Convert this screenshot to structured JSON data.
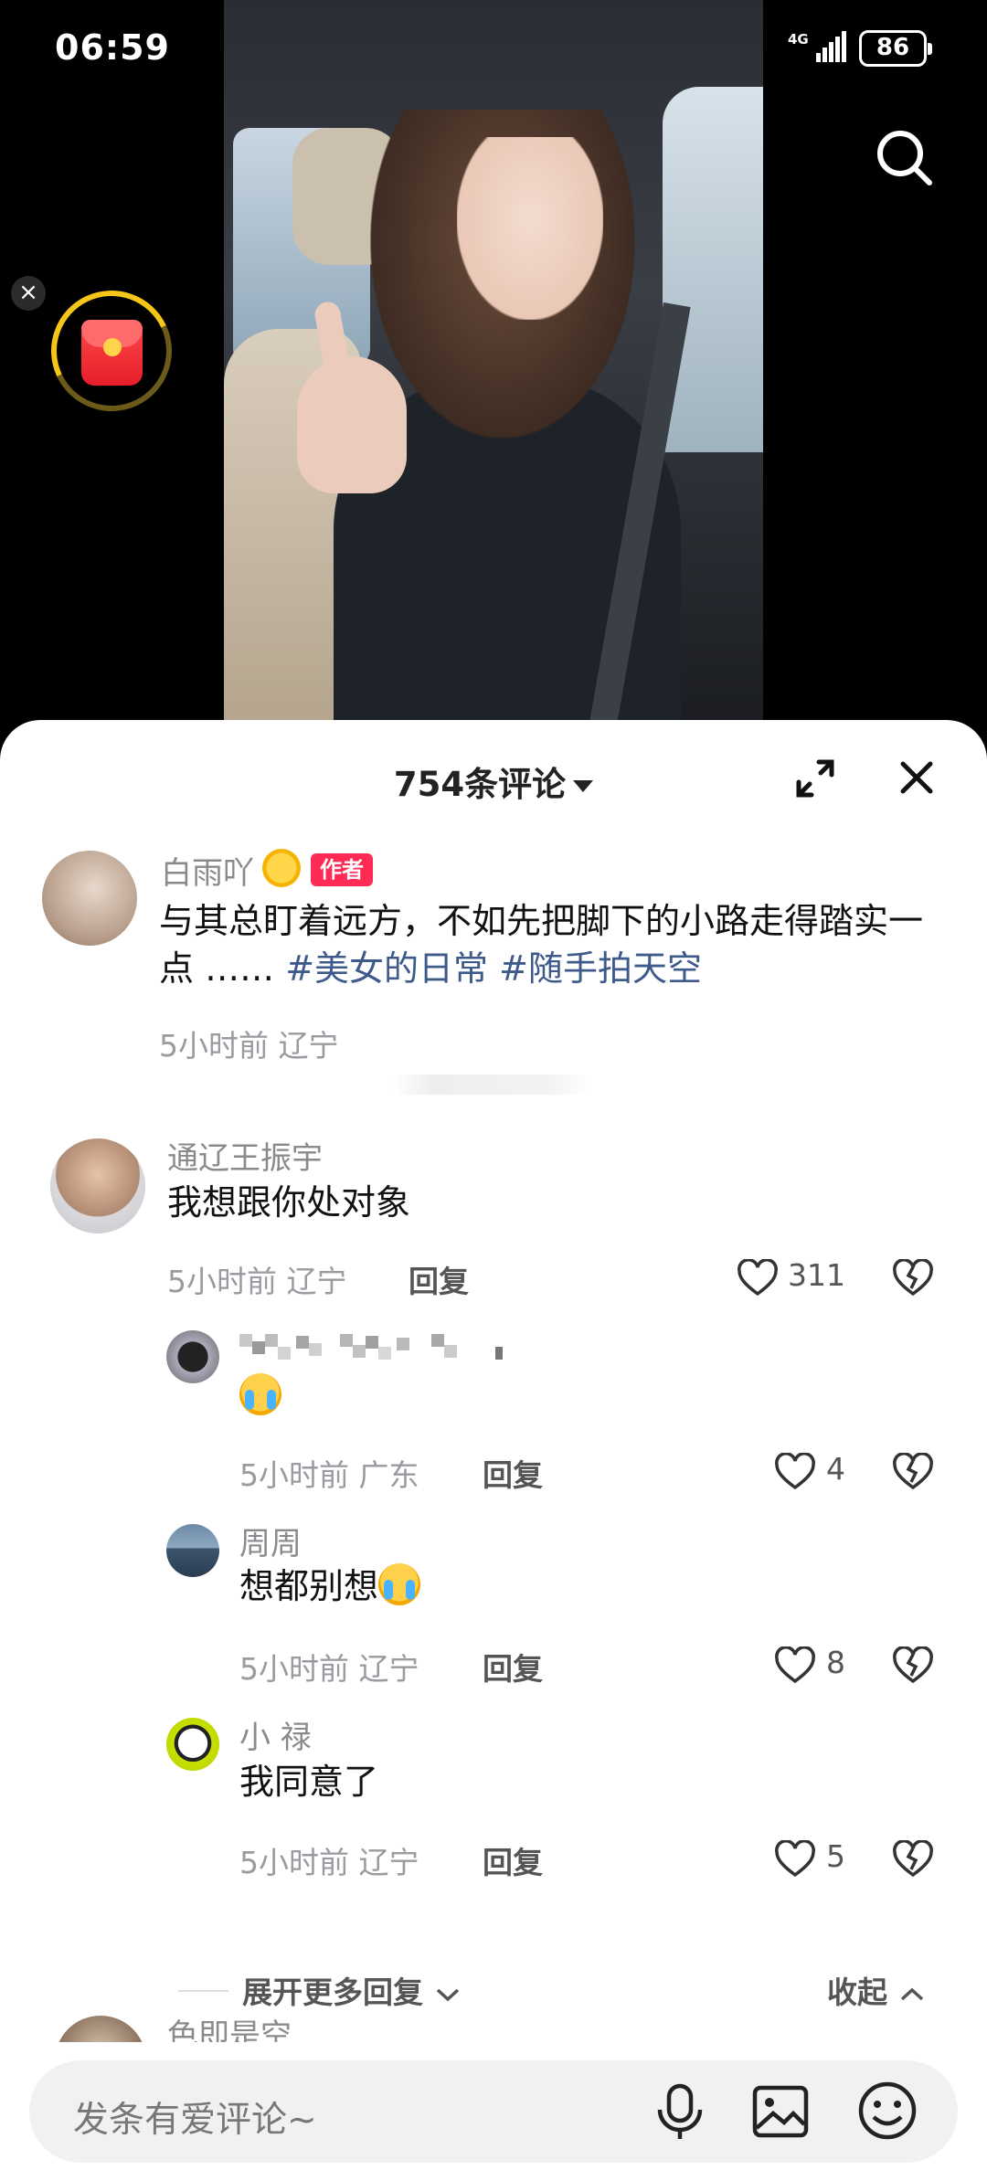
{
  "status_bar": {
    "time": "06:59",
    "network": "4G",
    "battery": "86"
  },
  "sheet": {
    "title": "754条评论"
  },
  "post": {
    "author_name": "白雨吖",
    "author_badge": "作者",
    "text_main": "与其总盯着远方，不如先把脚下的小路走得踏实一点 ……",
    "hashtags": [
      "#美女的日常",
      "#随手拍天空"
    ],
    "meta": "5小时前 辽宁"
  },
  "comments": [
    {
      "name": "通辽王振宇",
      "text": "我想跟你处对象",
      "meta": "5小时前 辽宁",
      "reply_label": "回复",
      "likes": "311"
    }
  ],
  "replies": [
    {
      "name": "",
      "text": "",
      "meta": "5小时前 广东",
      "reply_label": "回复",
      "likes": "4"
    },
    {
      "name": "周周",
      "text": "想都别想",
      "meta": "5小时前 辽宁",
      "reply_label": "回复",
      "likes": "8"
    },
    {
      "name": "小 禄",
      "text": "我同意了",
      "meta": "5小时前 辽宁",
      "reply_label": "回复",
      "likes": "5"
    }
  ],
  "thread_controls": {
    "expand_more": "展开更多回复",
    "collapse": "收起"
  },
  "next_comment_name": "色即是空",
  "input": {
    "placeholder": "发条有爱评论~"
  },
  "colors": {
    "accent": "#fe2c55",
    "hashtag": "#3d5a8a",
    "redpacket_ring": "#f5c518"
  }
}
